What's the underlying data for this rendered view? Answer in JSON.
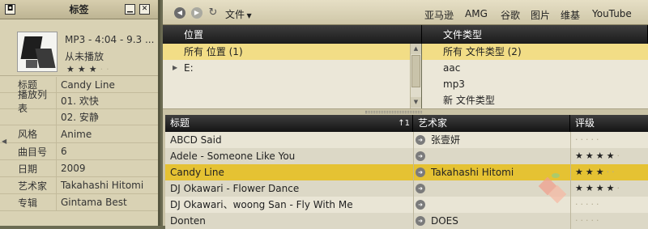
{
  "left_panel": {
    "title": "标签",
    "track_meta": "MP3 - 4:04 - 9.3 ...",
    "play_status": "从未播放",
    "rating": 3,
    "rating_max": 5,
    "properties": [
      {
        "label": "标题",
        "value": "Candy Line"
      },
      {
        "label": "播放列表",
        "value": "01. 欢快"
      },
      {
        "label": "",
        "value": "02. 安静"
      },
      {
        "label": "风格",
        "value": "Anime"
      },
      {
        "label": "曲目号",
        "value": "6"
      },
      {
        "label": "日期",
        "value": "2009"
      },
      {
        "label": "艺术家",
        "value": "Takahashi Hitomi"
      },
      {
        "label": "专辑",
        "value": "Gintama Best"
      }
    ]
  },
  "toolbar": {
    "file_menu": "文件",
    "services": [
      "亚马逊",
      "AMG",
      "谷歌",
      "图片",
      "维基",
      "YouTube"
    ]
  },
  "location_browser": {
    "header": "位置",
    "items": [
      {
        "label": "所有 位置 (1)",
        "selected": true
      },
      {
        "label": "E:",
        "selected": false,
        "expandable": true
      }
    ]
  },
  "filetype_browser": {
    "header": "文件类型",
    "items": [
      {
        "label": "所有 文件类型 (2)",
        "selected": true
      },
      {
        "label": "aac",
        "selected": false
      },
      {
        "label": "mp3",
        "selected": false
      },
      {
        "label": "新 文件类型",
        "selected": false
      }
    ]
  },
  "track_list": {
    "columns": {
      "title": "标题",
      "sort_indicator": "↑1",
      "artist": "艺术家",
      "rating": "评级"
    },
    "rows": [
      {
        "title": "ABCD Said",
        "artist": "张壹妍",
        "rating": 0
      },
      {
        "title": "Adele - Someone Like You",
        "artist": "",
        "rating": 4
      },
      {
        "title": "Candy Line",
        "artist": "Takahashi Hitomi",
        "rating": 3,
        "selected": true
      },
      {
        "title": "DJ Okawari - Flower Dance",
        "artist": "",
        "rating": 4
      },
      {
        "title": "DJ Okawari、woong San - Fly With Me",
        "artist": "",
        "rating": 0
      },
      {
        "title": "Donten",
        "artist": "DOES",
        "rating": 0
      }
    ]
  },
  "colors": {
    "selected_row": "#e5c233",
    "browser_selected": "#f2dd86",
    "header_dark": "#1b1b1b"
  }
}
